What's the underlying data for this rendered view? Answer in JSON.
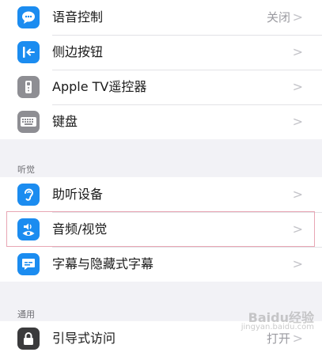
{
  "groups": [
    {
      "rows": [
        {
          "label": "语音控制",
          "value": "关闭",
          "icon": "speech-bubble-icon",
          "color": "#1b8cf0"
        },
        {
          "label": "侧边按钮",
          "value": "",
          "icon": "side-button-icon",
          "color": "#1b8cf0"
        },
        {
          "label": "Apple TV遥控器",
          "value": "",
          "icon": "remote-icon",
          "color": "#8e8e93"
        },
        {
          "label": "键盘",
          "value": "",
          "icon": "keyboard-icon",
          "color": "#8e8e93"
        }
      ]
    },
    {
      "header": "听觉",
      "rows": [
        {
          "label": "助听设备",
          "value": "",
          "icon": "ear-icon",
          "color": "#1b8cf0"
        },
        {
          "label": "音频/视觉",
          "value": "",
          "icon": "audio-visual-icon",
          "color": "#1b8cf0"
        },
        {
          "label": "字幕与隐藏式字幕",
          "value": "",
          "icon": "captions-icon",
          "color": "#1b8cf0"
        }
      ]
    },
    {
      "header": "通用",
      "rows": [
        {
          "label": "引导式访问",
          "value": "打开",
          "icon": "lock-icon",
          "color": "#3a3a3c"
        }
      ]
    }
  ],
  "chevron": ">",
  "watermark": {
    "line1": "Baidu经验",
    "line2": "jingyan.baidu.com"
  }
}
